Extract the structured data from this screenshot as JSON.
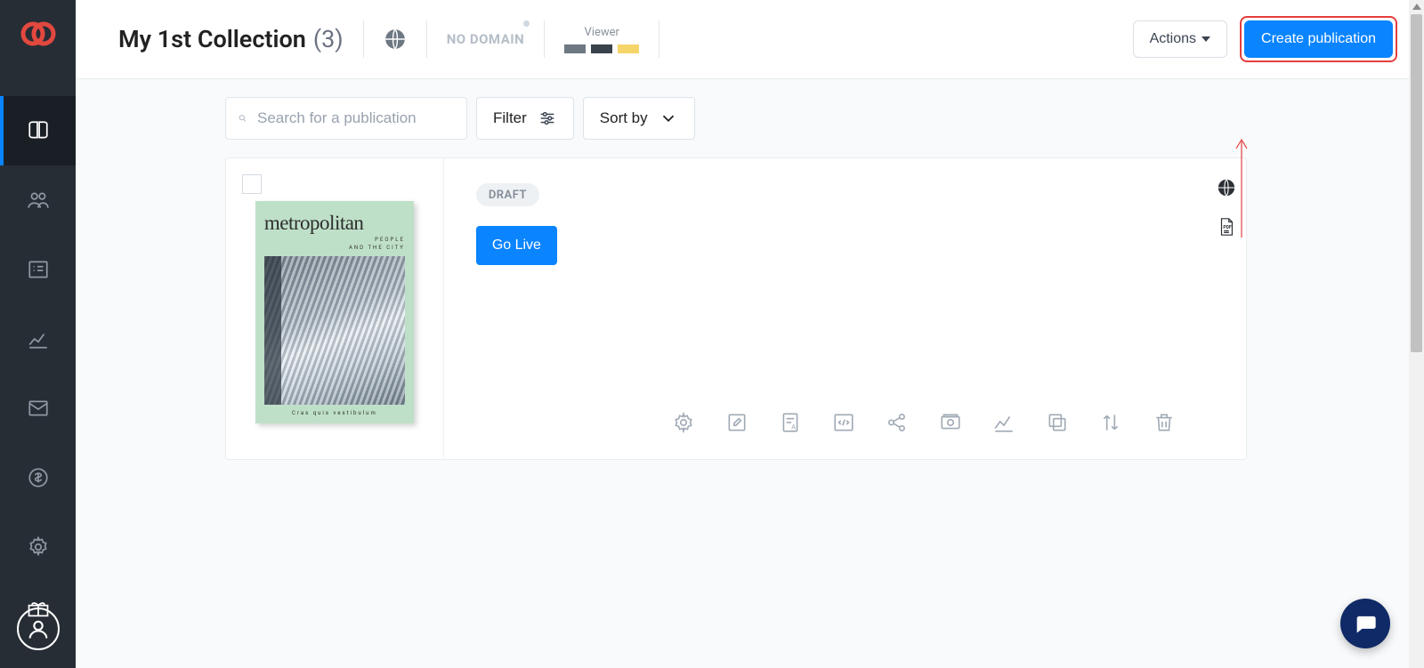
{
  "header": {
    "title": "My 1st Collection",
    "count": "(3)",
    "no_domain": "NO DOMAIN",
    "viewer_label": "Viewer",
    "swatches": [
      "#6e7883",
      "#3a424c",
      "#f5d56a"
    ],
    "actions_label": "Actions",
    "create_label": "Create publication"
  },
  "toolbar": {
    "search_placeholder": "Search for a publication",
    "filter_label": "Filter",
    "sort_label": "Sort by"
  },
  "publication": {
    "cover_title": "metropolitan",
    "cover_sub1": "PEOPLE",
    "cover_sub2": "AND THE CITY",
    "cover_footer": "Cras quis vestibulum",
    "status": "DRAFT",
    "go_live": "Go Live"
  }
}
